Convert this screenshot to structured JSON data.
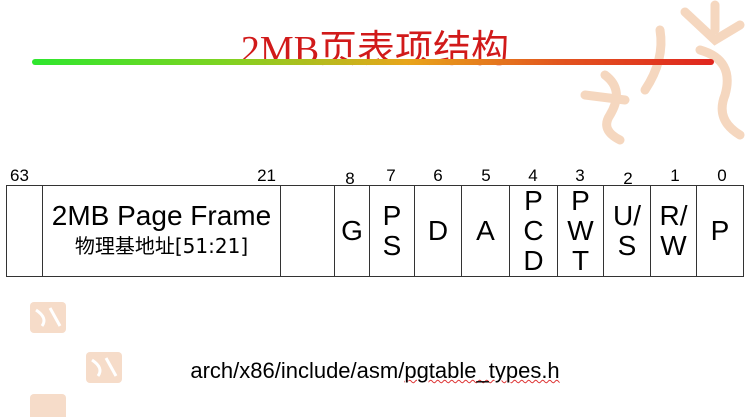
{
  "title": "2MB页表项结构",
  "bit_numbers": {
    "b63": "63",
    "b21": "21",
    "b8": "8",
    "b7": "7",
    "b6": "6",
    "b5": "5",
    "b4": "4",
    "b3": "3",
    "b2": "2",
    "b1": "1",
    "b0": "0"
  },
  "fields": {
    "frame_line1": "2MB Page Frame",
    "frame_line2": "物理基地址[51:21]",
    "g": "G",
    "ps": [
      "P",
      "S"
    ],
    "d": "D",
    "a": "A",
    "pcd": [
      "P",
      "C",
      "D"
    ],
    "pwt": [
      "P",
      "W",
      "T"
    ],
    "us": [
      "U/",
      "S"
    ],
    "rw": [
      "R/",
      "W"
    ],
    "p": "P"
  },
  "path": {
    "prefix": "arch/x86/include/asm/",
    "file": "pgtable_types.h"
  },
  "colors": {
    "title": "#d11a1a",
    "bar_start": "#2ee62e",
    "bar_end": "#e0261f"
  }
}
